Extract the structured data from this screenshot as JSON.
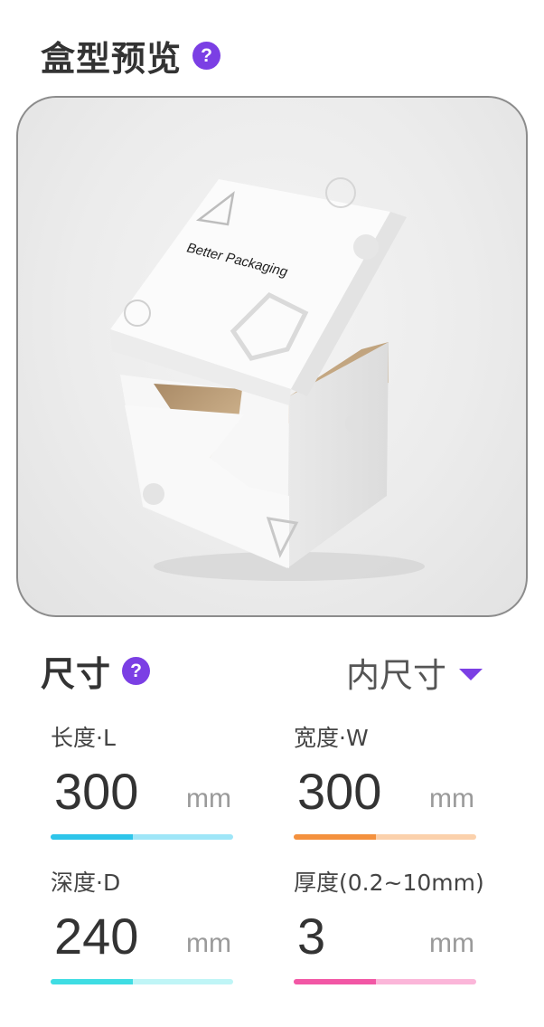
{
  "preview": {
    "title": "盒型预览",
    "help_icon": "question-circle-icon",
    "box_print": "Better Packaging"
  },
  "size": {
    "title": "尺寸",
    "help_icon": "question-circle-icon",
    "mode_label": "内尺寸",
    "mode_icon": "caret-down-icon"
  },
  "dimensions": [
    {
      "label": "长度·L",
      "value": "300",
      "unit": "mm",
      "bar_color": "#2ec5ea",
      "bar_track": "#9fe6f8"
    },
    {
      "label": "宽度·W",
      "value": "300",
      "unit": "mm",
      "bar_color": "#f4913e",
      "bar_track": "#fbd1ac"
    },
    {
      "label": "深度·D",
      "value": "240",
      "unit": "mm",
      "bar_color": "#3fdde3",
      "bar_track": "#bff5f6"
    },
    {
      "label": "厚度(0.2~10mm)",
      "value": "3",
      "unit": "mm",
      "bar_color": "#f257a5",
      "bar_track": "#fbb6d9"
    }
  ],
  "colors": {
    "accent": "#7b3fe4"
  }
}
